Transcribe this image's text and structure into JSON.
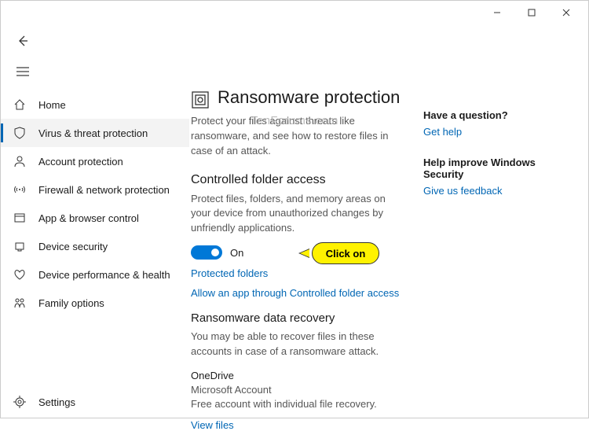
{
  "titlebar": {
    "minimize": "−",
    "maximize": "□",
    "close": "×"
  },
  "sidebar": {
    "items": [
      {
        "label": "Home"
      },
      {
        "label": "Virus & threat protection"
      },
      {
        "label": "Account protection"
      },
      {
        "label": "Firewall & network protection"
      },
      {
        "label": "App & browser control"
      },
      {
        "label": "Device security"
      },
      {
        "label": "Device performance & health"
      },
      {
        "label": "Family options"
      }
    ],
    "settings": "Settings"
  },
  "main": {
    "title": "Ransomware protection",
    "intro": "Protect your files against threats like ransomware, and see how to restore files in case of an attack.",
    "cfa_title": "Controlled folder access",
    "cfa_desc": "Protect files, folders, and memory areas on your device from unauthorized changes by unfriendly applications.",
    "toggle_label": "On",
    "link_protected": "Protected folders",
    "link_allow": "Allow an app through Controlled folder access",
    "recovery_title": "Ransomware data recovery",
    "recovery_desc": "You may be able to recover files in these accounts in case of a ransomware attack.",
    "onedrive": "OneDrive",
    "ms_account": "Microsoft Account",
    "ms_desc": "Free account with individual file recovery.",
    "view_files": "View files"
  },
  "right": {
    "q_head": "Have a question?",
    "get_help": "Get help",
    "improve_head": "Help improve Windows Security",
    "feedback": "Give us feedback"
  },
  "callout": {
    "text": "Click on"
  },
  "watermark": "TenForums.com"
}
